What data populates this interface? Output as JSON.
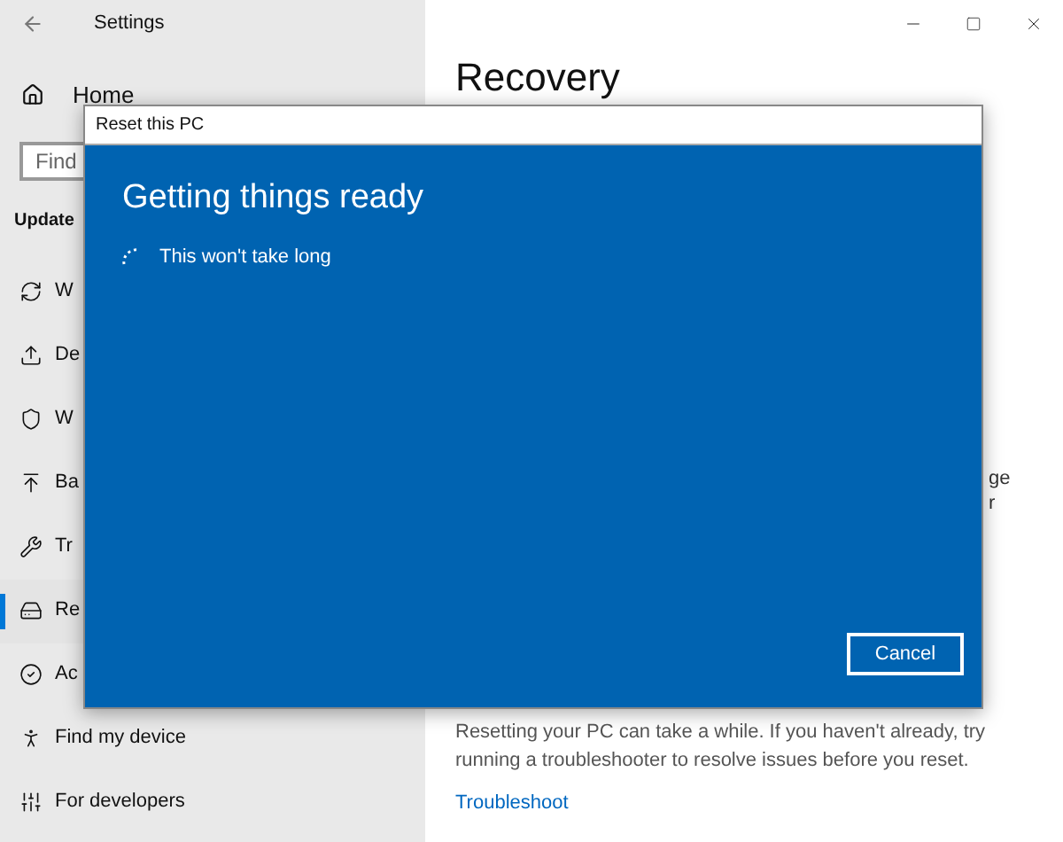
{
  "window": {
    "title": "Settings"
  },
  "sidebar": {
    "home": "Home",
    "search": {
      "placeholder": "Find"
    },
    "section": "Update",
    "items": [
      {
        "label": "W",
        "selected": false
      },
      {
        "label": "De",
        "selected": false
      },
      {
        "label": "W",
        "selected": false
      },
      {
        "label": "Ba",
        "selected": false
      },
      {
        "label": "Tr",
        "selected": false
      },
      {
        "label": "Re",
        "selected": true
      },
      {
        "label": "Ac",
        "selected": false
      },
      {
        "label": "Find my device",
        "selected": false
      },
      {
        "label": "For developers",
        "selected": false
      }
    ]
  },
  "page": {
    "title": "Recovery",
    "fragments": [
      "ge",
      "r"
    ],
    "note": "Resetting your PC can take a while. If you haven't already, try running a troubleshooter to resolve issues before you reset.",
    "link": "Troubleshoot"
  },
  "dialog": {
    "title": "Reset this PC",
    "heading": "Getting things ready",
    "status": "This won't take long",
    "button": "Cancel"
  }
}
